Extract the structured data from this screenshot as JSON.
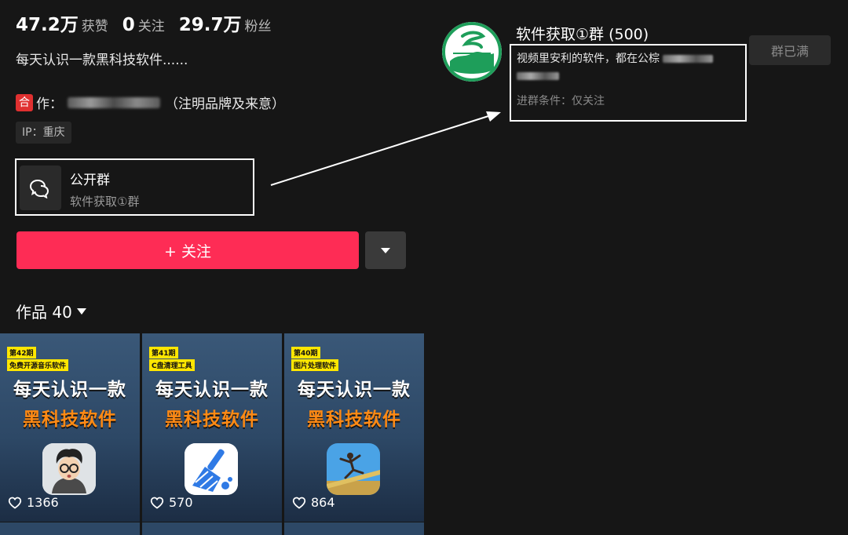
{
  "stats": [
    {
      "num": "47.2万",
      "label": "获赞"
    },
    {
      "num": "0",
      "label": "关注"
    },
    {
      "num": "29.7万",
      "label": "粉丝"
    }
  ],
  "bio": "每天认识一款黑科技软件......",
  "contact": {
    "badge": "合",
    "prefix": "作：",
    "suffix": "（注明品牌及来意）"
  },
  "ip": "IP：重庆",
  "public_group": {
    "title": "公开群",
    "subtitle": "软件获取①群"
  },
  "follow_label": "+ 关注",
  "works": {
    "label": "作品 40"
  },
  "videos": [
    {
      "episode": "第42期",
      "topic": "免费开源音乐软件",
      "line1": "每天认识一款",
      "line2": "黑科技软件",
      "likes": "1366",
      "icon": "cartoon-avatar-icon"
    },
    {
      "episode": "第41期",
      "topic": "C盘清理工具",
      "line1": "每天认识一款",
      "line2": "黑科技软件",
      "likes": "570",
      "icon": "broom-icon"
    },
    {
      "episode": "第40期",
      "topic": "图片处理软件",
      "line1": "每天认识一款",
      "line2": "黑科技软件",
      "likes": "864",
      "icon": "photo-person-icon"
    }
  ],
  "group_detail": {
    "title": "软件获取①群 (500)",
    "status_button": "群已满",
    "description": "视频里安利的软件，都在公棕",
    "condition": "进群条件：仅关注"
  },
  "colors": {
    "accent": "#fe2c55",
    "background": "#161616",
    "tile": "#2d4866",
    "highlight": "#ff8a14",
    "tag": "#ffe600"
  }
}
